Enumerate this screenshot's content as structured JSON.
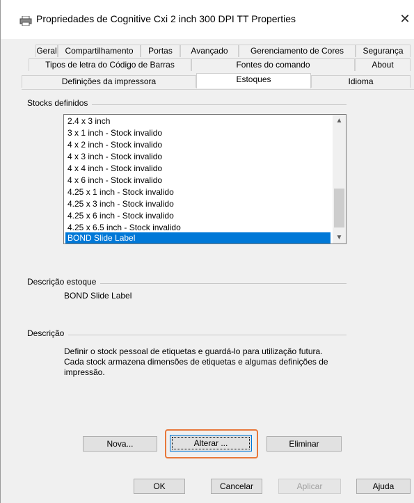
{
  "window": {
    "title": "Propriedades de Cognitive Cxi 2 inch 300 DPI TT Properties",
    "close_symbol": "✕"
  },
  "tabs": {
    "row1": [
      "Geral",
      "Compartilhamento",
      "Portas",
      "Avançado",
      "Gerenciamento de Cores",
      "Segurança"
    ],
    "row2": [
      "Tipos de letra do Código de Barras",
      "Fontes do comando",
      "About"
    ],
    "row3": [
      "Definições da impressora",
      "Estoques",
      "Idioma"
    ],
    "active": "Estoques"
  },
  "stocks": {
    "label": "Stocks definidos",
    "items": [
      "2.4 x 3 inch",
      "3 x 1 inch - Stock invalido",
      "4 x 2 inch - Stock invalido",
      "4 x 3 inch - Stock invalido",
      "4 x 4 inch - Stock invalido",
      "4 x 6 inch - Stock invalido",
      "4.25 x 1 inch - Stock invalido",
      "4.25 x 3 inch - Stock invalido",
      "4.25 x 6 inch - Stock invalido",
      "4.25 x 6.5 inch - Stock invalido",
      "BOND Slide Label"
    ],
    "selected": "BOND Slide Label"
  },
  "stock_description": {
    "label": "Descrição estoque",
    "value": "BOND Slide Label"
  },
  "description": {
    "label": "Descrição",
    "text": "Definir o stock pessoal de etiquetas e guardá-lo para utilização futura. Cada stock armazena dimensões de etiquetas e algumas definições de impressão."
  },
  "stock_buttons": {
    "new": "Nova...",
    "edit": "Alterar ...",
    "delete": "Eliminar"
  },
  "dialog_buttons": {
    "ok": "OK",
    "cancel": "Cancelar",
    "apply": "Aplicar",
    "help": "Ajuda"
  },
  "colors": {
    "selection": "#0078d7",
    "highlight": "#e8783a"
  },
  "icons": {
    "title": "printer-icon",
    "scroll_up": "chevron-up-icon",
    "scroll_down": "chevron-down-icon"
  }
}
